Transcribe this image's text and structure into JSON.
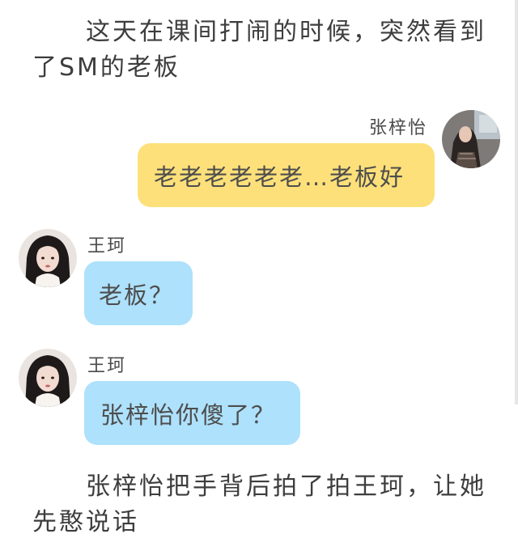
{
  "narration": {
    "top": "这天在课间打闹的时候，突然看到了SM的老板",
    "bottom": "张梓怡把手背后拍了拍王珂，让她先憨说话"
  },
  "messages": [
    {
      "sender": "张梓怡",
      "text": "老老老老老老…老板好",
      "side": "right",
      "bubble_color": "#fde07a",
      "avatar": "avatar-photo-icon"
    },
    {
      "sender": "王珂",
      "text": "老板？",
      "side": "left",
      "bubble_color": "#aee1fb",
      "avatar": "avatar-photo-icon"
    },
    {
      "sender": "王珂",
      "text": "张梓怡你傻了？",
      "side": "left",
      "bubble_color": "#aee1fb",
      "avatar": "avatar-photo-icon"
    }
  ]
}
